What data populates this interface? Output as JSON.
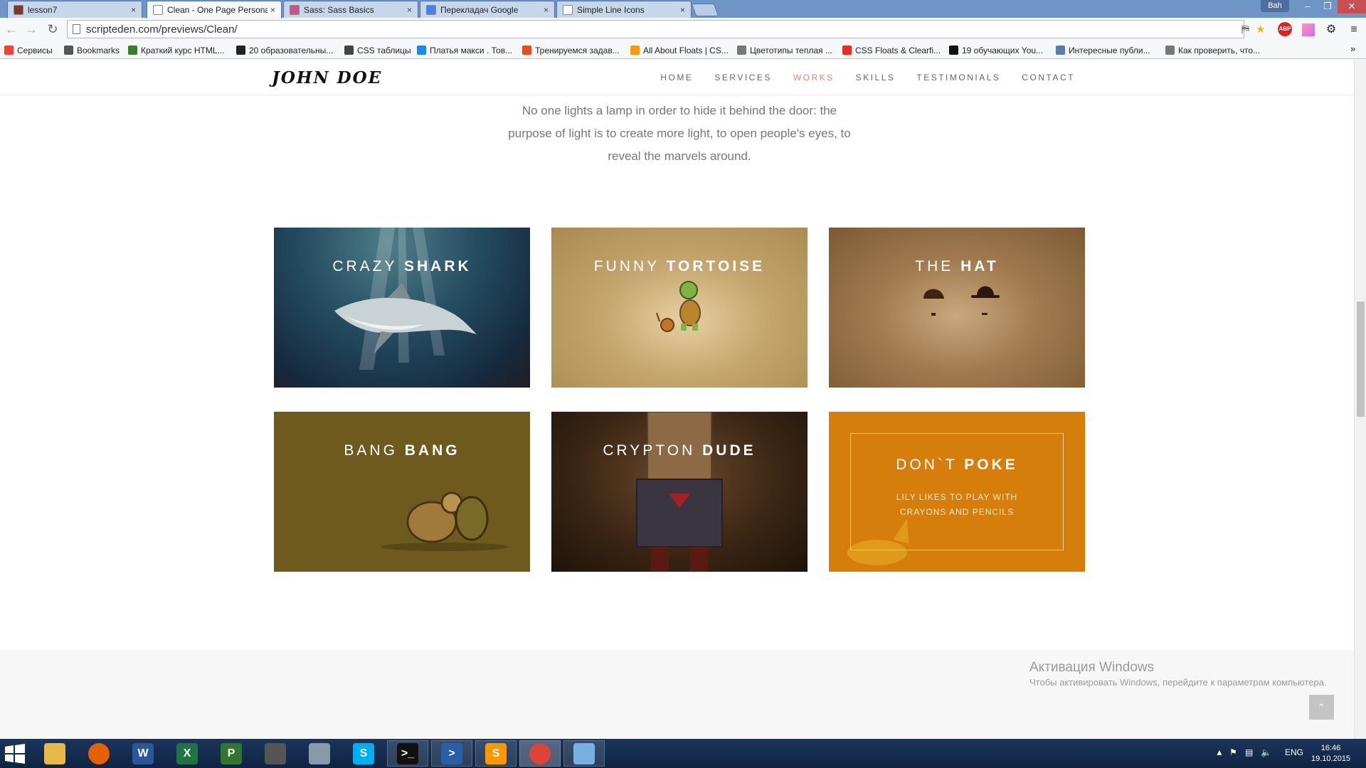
{
  "browser": {
    "tabs": [
      {
        "title": "lesson7",
        "favicon": "hat-icon",
        "color": "#7a3b2e"
      },
      {
        "title": "Clean - One Page Persona",
        "favicon": "page-icon",
        "color": "#ffffff"
      },
      {
        "title": "Sass: Sass Basics",
        "favicon": "sass-icon",
        "color": "#c6538c"
      },
      {
        "title": "Перекладач Google",
        "favicon": "translate-icon",
        "color": "#4a7ff0"
      },
      {
        "title": "Simple Line Icons",
        "favicon": "page-icon",
        "color": "#ffffff"
      }
    ],
    "user_badge": "Bah",
    "url": "scripteden.com/previews/Clean/",
    "bookmarks": [
      {
        "label": "Сервисы",
        "icon": "apps-icon",
        "color": "#e8453c"
      },
      {
        "label": "Bookmarks",
        "icon": "star-icon",
        "color": "#555555"
      },
      {
        "label": "Краткий курс HTML...",
        "icon": "globe-icon",
        "color": "#3a7d2e"
      },
      {
        "label": "20 образовательны...",
        "icon": "ad-icon",
        "color": "#222222"
      },
      {
        "label": "CSS таблицы",
        "icon": "table-icon",
        "color": "#444444"
      },
      {
        "label": "Платья макси . Тов...",
        "icon": "bird-icon",
        "color": "#1e88e5"
      },
      {
        "label": "Тренируемся задав...",
        "icon": "html5-icon",
        "color": "#e44d26"
      },
      {
        "label": "All About Floats | CS...",
        "icon": "asterisk-icon",
        "color": "#f39c12"
      },
      {
        "label": "Цветотипы теплая ...",
        "icon": "page-icon",
        "color": "#777777"
      },
      {
        "label": "CSS Floats & Clearfi...",
        "icon": "youtube-icon",
        "color": "#e52d27"
      },
      {
        "label": "19 обучающих You...",
        "icon": "alm-icon",
        "color": "#111111"
      },
      {
        "label": "Интересные публи...",
        "icon": "h-icon",
        "color": "#5a7aa8"
      },
      {
        "label": "Как проверить, что...",
        "icon": "page-icon",
        "color": "#777777"
      }
    ]
  },
  "site": {
    "logo": "JOHN DOE",
    "nav": [
      {
        "label": "HOME"
      },
      {
        "label": "SERVICES"
      },
      {
        "label": "WORKS",
        "active": true
      },
      {
        "label": "SKILLS"
      },
      {
        "label": "TESTIMONIALS"
      },
      {
        "label": "CONTACT"
      }
    ],
    "quote_lines": [
      "No one lights a lamp in order to hide it behind the door: the",
      "purpose of light is to create more light, to open people's eyes, to",
      "reveal the marvels around."
    ],
    "works": [
      {
        "title_light": "CRAZY",
        "title_bold": "SHARK"
      },
      {
        "title_light": "FUNNY",
        "title_bold": "TORTOISE"
      },
      {
        "title_light": "THE",
        "title_bold": "HAT"
      },
      {
        "title_light": "BANG",
        "title_bold": "BANG"
      },
      {
        "title_light": "CRYPTON",
        "title_bold": "DUDE"
      },
      {
        "title_light": "DON`T",
        "title_bold": "POKE",
        "caption_lines": [
          "LILY LIKES TO PLAY WITH",
          "CRAYONS AND PENCILS"
        ]
      }
    ],
    "accent_color": "#e8847a"
  },
  "watermark": {
    "title": "Активация Windows",
    "text": "Чтобы активировать Windows, перейдите к параметрам компьютера."
  },
  "taskbar": {
    "apps": [
      {
        "name": "file-explorer-icon",
        "color": "#e6b94a"
      },
      {
        "name": "firefox-icon",
        "color": "#e66000"
      },
      {
        "name": "word-icon",
        "color": "#2b579a",
        "glyph": "W"
      },
      {
        "name": "excel-icon",
        "color": "#217346",
        "glyph": "X"
      },
      {
        "name": "project-icon",
        "color": "#31752f",
        "glyph": "P"
      },
      {
        "name": "camera-icon",
        "color": "#555555"
      },
      {
        "name": "calculator-icon",
        "color": "#8899aa"
      },
      {
        "name": "skype-icon",
        "color": "#00aff0",
        "glyph": "S"
      },
      {
        "name": "terminal-icon",
        "color": "#111111",
        "glyph": ">_"
      },
      {
        "name": "powershell-icon",
        "color": "#2a5ea7",
        "glyph": ">"
      },
      {
        "name": "sublime-icon",
        "color": "#ff9800",
        "glyph": "S"
      },
      {
        "name": "chrome-icon",
        "color": "#db4437"
      },
      {
        "name": "paint-icon",
        "color": "#7ab0e0"
      }
    ],
    "language": "ENG",
    "time": "16:46",
    "date": "19.10.2015"
  }
}
